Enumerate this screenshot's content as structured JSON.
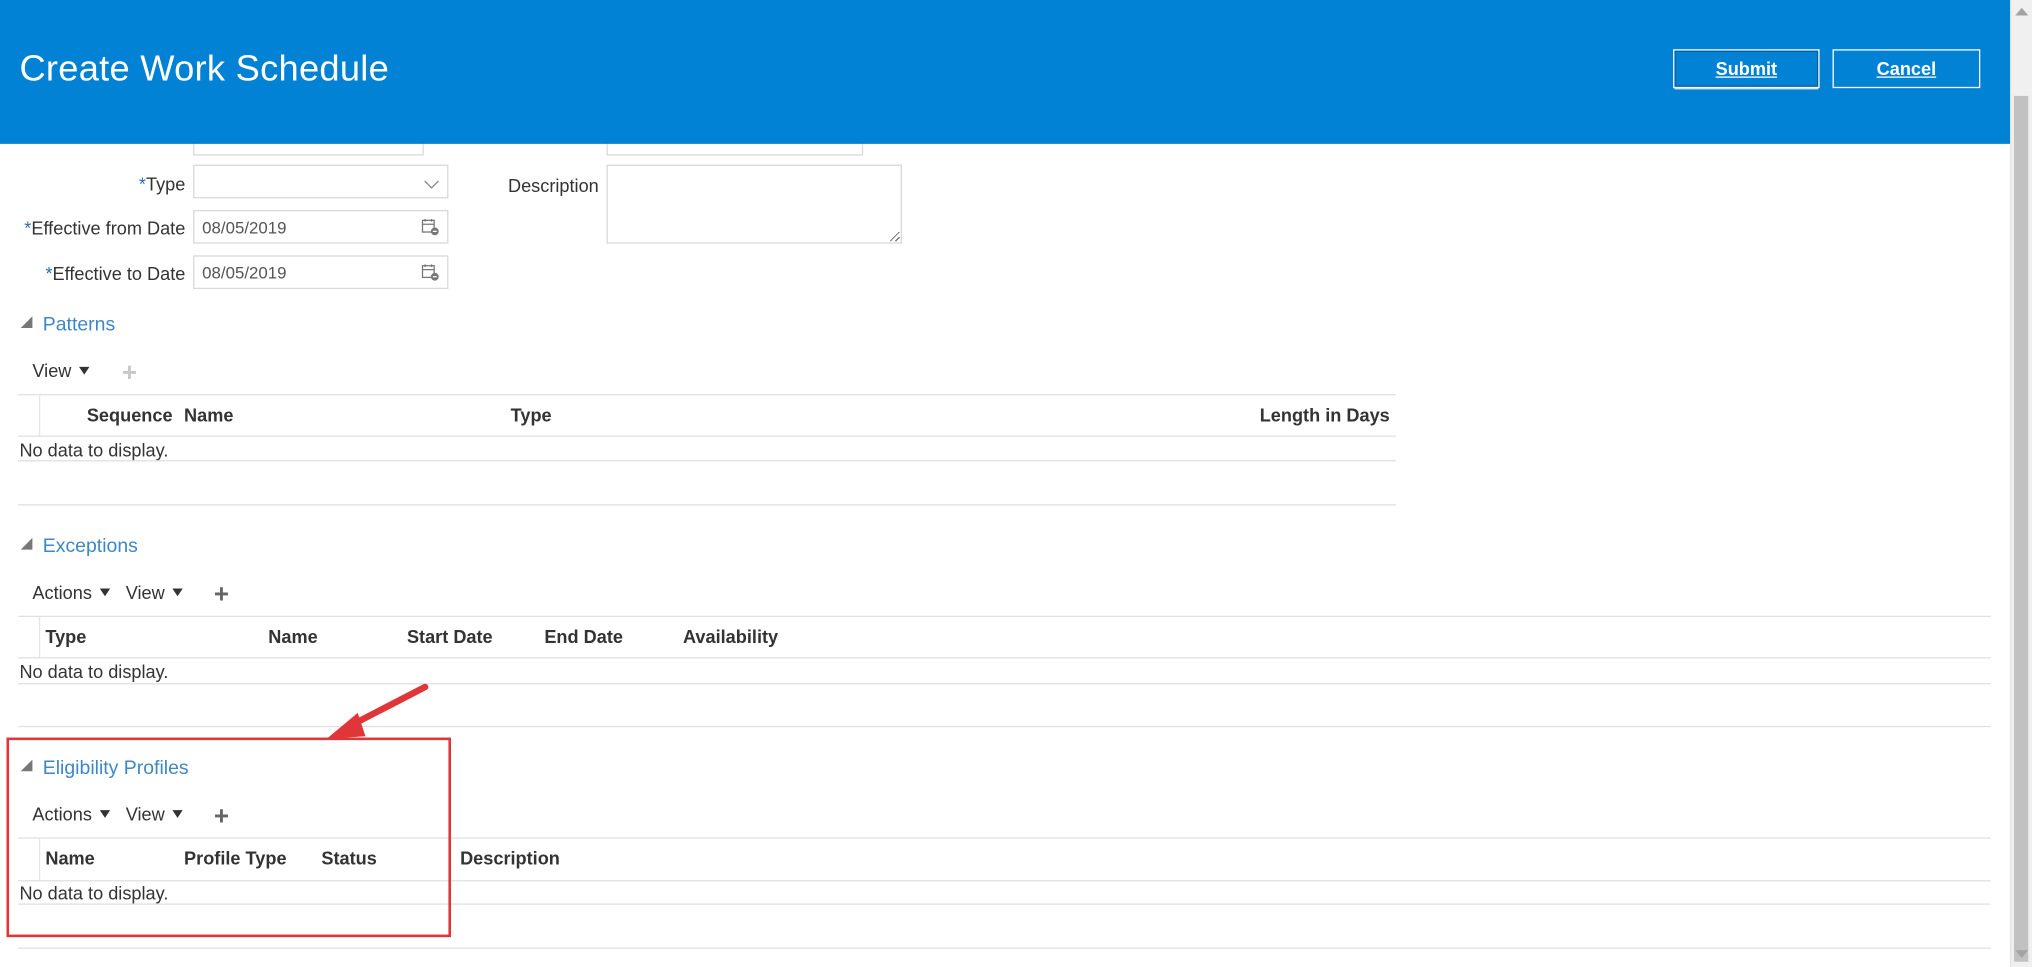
{
  "header": {
    "title": "Create Work Schedule",
    "submit_label": "Submit",
    "cancel_label": "Cancel"
  },
  "form": {
    "type_label": "Type",
    "effective_from_label": "Effective from Date",
    "effective_from_value": "08/05/2019",
    "effective_to_label": "Effective to Date",
    "effective_to_value": "08/05/2019",
    "description_label": "Description",
    "required_mark": "*"
  },
  "patterns": {
    "title": "Patterns",
    "view_label": "View",
    "columns": [
      "Sequence",
      "Name",
      "Type",
      "Length in Days"
    ],
    "empty_text": "No data to display."
  },
  "exceptions": {
    "title": "Exceptions",
    "actions_label": "Actions",
    "view_label": "View",
    "columns": [
      "Type",
      "Name",
      "Start Date",
      "End Date",
      "Availability"
    ],
    "empty_text": "No data to display."
  },
  "eligibility": {
    "title": "Eligibility Profiles",
    "actions_label": "Actions",
    "view_label": "View",
    "columns": [
      "Name",
      "Profile Type",
      "Status",
      "Description"
    ],
    "empty_text": "No data to display."
  },
  "colors": {
    "header_bg": "#0282d4",
    "section_title": "#3d88c4",
    "highlight": "#e0363a"
  }
}
